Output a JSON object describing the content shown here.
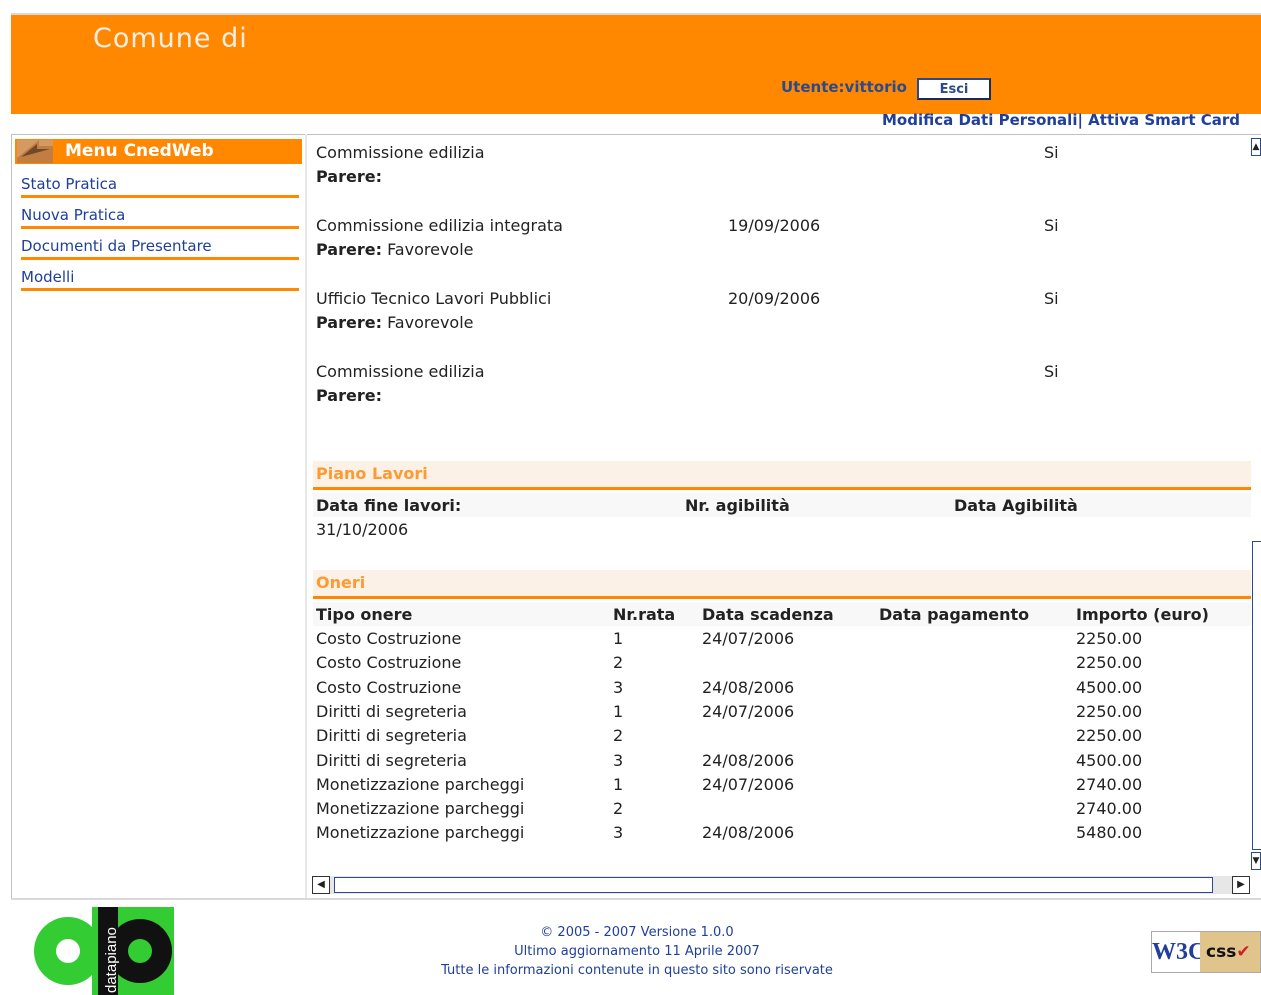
{
  "header": {
    "title": "Comune di",
    "user_label": "Utente:vittorio",
    "logout_label": "Esci",
    "link_profile": "Modifica Dati Personali|",
    "link_smartcard": " Attiva Smart Card"
  },
  "menu": {
    "title": "Menu  CnedWeb",
    "items": [
      "Stato Pratica",
      "Nuova Pratica",
      "Documenti da Presentare",
      "Modelli"
    ]
  },
  "pareri": [
    {
      "name": "Commissione edilizia",
      "date": "",
      "flag": "Si",
      "parere_label": "Parere:",
      "parere_value": ""
    },
    {
      "name": "Commissione edilizia integrata",
      "date": "19/09/2006",
      "flag": "Si",
      "parere_label": "Parere:",
      "parere_value": " Favorevole"
    },
    {
      "name": "Ufficio Tecnico Lavori Pubblici",
      "date": "20/09/2006",
      "flag": "Si",
      "parere_label": "Parere:",
      "parere_value": " Favorevole"
    },
    {
      "name": "Commissione edilizia",
      "date": "",
      "flag": "Si",
      "parere_label": "Parere:",
      "parere_value": ""
    }
  ],
  "piano_lavori": {
    "title": "Piano Lavori",
    "col_fine": "Data fine lavori:",
    "col_agibilita_nr": "Nr. agibilità",
    "col_agibilita_data": "Data Agibilità",
    "fine_value": "31/10/2006"
  },
  "oneri": {
    "title": "Oneri",
    "columns": [
      "Tipo onere",
      "Nr.rata",
      "Data scadenza",
      "Data pagamento",
      "Importo (euro)"
    ],
    "rows": [
      [
        "Costo Costruzione",
        "1",
        "24/07/2006",
        "",
        "2250.00"
      ],
      [
        "Costo Costruzione",
        "2",
        "",
        "",
        "2250.00"
      ],
      [
        "Costo Costruzione",
        "3",
        "24/08/2006",
        "",
        "4500.00"
      ],
      [
        "Diritti di segreteria",
        "1",
        "24/07/2006",
        "",
        "2250.00"
      ],
      [
        "Diritti di segreteria",
        "2",
        "",
        "",
        "2250.00"
      ],
      [
        "Diritti di segreteria",
        "3",
        "24/08/2006",
        "",
        "4500.00"
      ],
      [
        "Monetizzazione parcheggi",
        "1",
        "24/07/2006",
        "",
        "2740.00"
      ],
      [
        "Monetizzazione parcheggi",
        "2",
        "",
        "",
        "2740.00"
      ],
      [
        "Monetizzazione parcheggi",
        "3",
        "24/08/2006",
        "",
        "5480.00"
      ]
    ]
  },
  "footer": {
    "copyright": "© 2005 - 2007 Versione 1.0.0",
    "updated": "Ultimo aggiornamento 11 Aprile 2007",
    "rights": "Tutte le informazioni contenute in questo sito sono riservate",
    "logo_text": "datapiano",
    "w3c_left": "W3C",
    "w3c_right": "css"
  },
  "colors": {
    "accent": "#ff8800",
    "link": "#1f3f9b",
    "section_title": "#ff9a33"
  },
  "icons": {
    "menu_header": "back-arrow-icon",
    "scroll_left": "arrow-left-icon",
    "scroll_right": "arrow-right-icon",
    "scroll_up": "arrow-up-icon",
    "scroll_down": "arrow-down-icon"
  }
}
